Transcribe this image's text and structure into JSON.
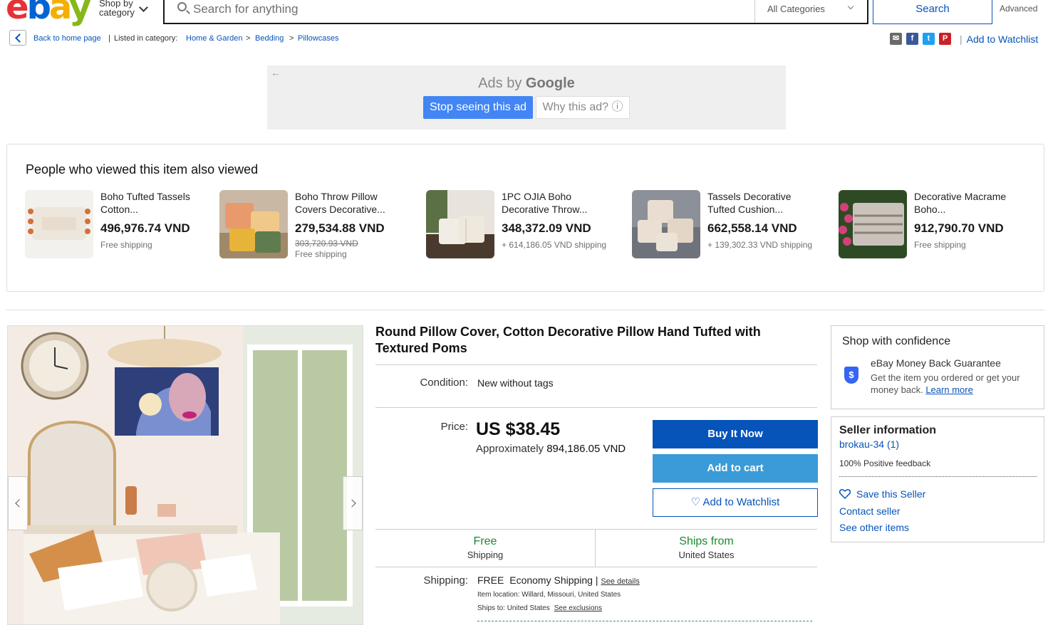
{
  "header": {
    "logo": {
      "e": "e",
      "b": "b",
      "a": "a",
      "y": "y"
    },
    "shop_by_label": "Shop by category",
    "search_placeholder": "Search for anything",
    "category_select": "All Categories",
    "search_button": "Search",
    "advanced_link": "Advanced"
  },
  "breadcrumb": {
    "back_label": "Back to home page",
    "listed_label": "Listed in category:",
    "items": [
      "Home & Garden",
      "Bedding",
      "Pillowcases"
    ],
    "separator": ">"
  },
  "share": {
    "icons": [
      {
        "name": "email-icon",
        "glyph": "✉",
        "color": "#6a6a6a"
      },
      {
        "name": "facebook-icon",
        "glyph": "f",
        "color": "#3b5998"
      },
      {
        "name": "twitter-icon",
        "glyph": "t",
        "color": "#1da1f2"
      },
      {
        "name": "pinterest-icon",
        "glyph": "P",
        "color": "#cb2027"
      }
    ],
    "watchlist_label": "Add to Watchlist"
  },
  "ad": {
    "ads_by": "Ads by",
    "google": "Google",
    "stop_button": "Stop seeing this ad",
    "why_button": "Why this ad? ⓘ"
  },
  "also_viewed": {
    "title": "People who viewed this item also viewed",
    "items": [
      {
        "name": "Boho Tufted Tassels Cotton...",
        "price": "496,976.74 VND",
        "old_price": "",
        "shipping": "Free shipping"
      },
      {
        "name": "Boho Throw Pillow Covers Decorative...",
        "price": "279,534.88 VND",
        "old_price": "303,720.93 VND",
        "shipping": "Free shipping"
      },
      {
        "name": "1PC OJIA Boho Decorative Throw...",
        "price": "348,372.09 VND",
        "old_price": "",
        "shipping": "+ 614,186.05 VND shipping"
      },
      {
        "name": "Tassels Decorative Tufted Cushion...",
        "price": "662,558.14 VND",
        "old_price": "",
        "shipping": "+ 139,302.33 VND shipping"
      },
      {
        "name": "Decorative Macrame Boho...",
        "price": "912,790.70 VND",
        "old_price": "",
        "shipping": "Free shipping"
      }
    ]
  },
  "product": {
    "title": "Round Pillow Cover, Cotton Decorative Pillow Hand Tufted with Textured Poms",
    "condition_label": "Condition:",
    "condition_value": "New without tags",
    "price_label": "Price:",
    "price": "US $38.45",
    "approx_label": "Approximately",
    "approx_value": "894,186.05 VND",
    "buy_now": "Buy It Now",
    "add_to_cart": "Add to cart",
    "add_to_watchlist": "♡ Add to Watchlist",
    "ship_free_big": "Free",
    "ship_free_small": "Shipping",
    "ships_from_big": "Ships from",
    "ships_from_small": "United States",
    "shipping_label": "Shipping:",
    "shipping_free": "FREE",
    "shipping_method": "Economy Shipping |",
    "see_details": "See details",
    "item_location": "Item location:  Willard, Missouri, United States",
    "ships_to": "Ships to:  United States",
    "see_exclusions": "See exclusions"
  },
  "confidence": {
    "title": "Shop with confidence",
    "guarantee_title": "eBay Money Back Guarantee",
    "guarantee_desc": "Get the item you ordered or get your money back.",
    "learn_more": "Learn more",
    "shield_glyph": "$"
  },
  "seller": {
    "title": "Seller information",
    "name": "brokau-34",
    "score": "(1)",
    "feedback": "100% Positive feedback",
    "save_seller": "Save this Seller",
    "contact": "Contact seller",
    "other_items": "See other items"
  }
}
